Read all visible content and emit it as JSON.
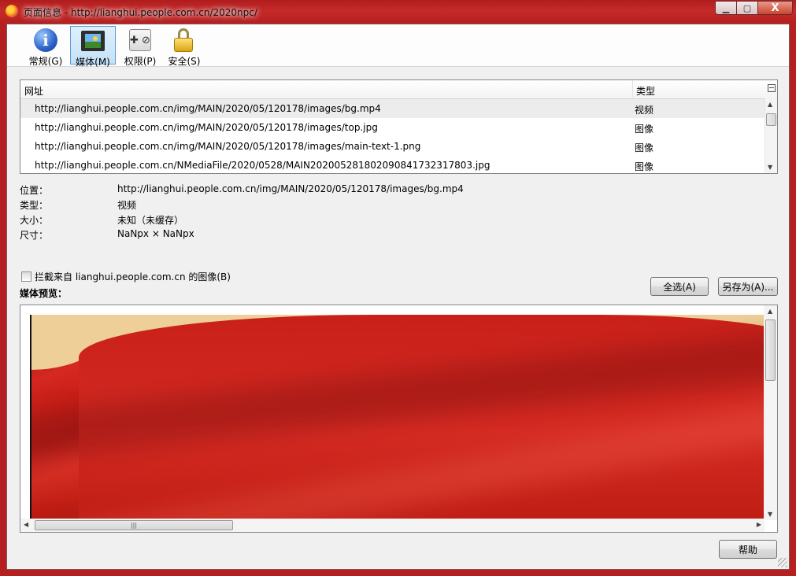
{
  "window": {
    "title": "页面信息 - http://lianghui.people.com.cn/2020npc/",
    "caption_buttons": {
      "minimize": "▁",
      "maximize": "▢",
      "close": "X"
    }
  },
  "toolbar": {
    "tabs": [
      {
        "label": "常规(G)",
        "icon": "info-icon",
        "selected": false
      },
      {
        "label": "媒体(M)",
        "icon": "media-icon",
        "selected": true
      },
      {
        "label": "权限(P)",
        "icon": "permissions-icon",
        "selected": false
      },
      {
        "label": "安全(S)",
        "icon": "lock-icon",
        "selected": false
      }
    ]
  },
  "media_table": {
    "headers": {
      "url": "网址",
      "type": "类型"
    },
    "rows": [
      {
        "url": "http://lianghui.people.com.cn/img/MAIN/2020/05/120178/images/bg.mp4",
        "type": "视频",
        "selected": true
      },
      {
        "url": "http://lianghui.people.com.cn/img/MAIN/2020/05/120178/images/top.jpg",
        "type": "图像",
        "selected": false
      },
      {
        "url": "http://lianghui.people.com.cn/img/MAIN/2020/05/120178/images/main-text-1.png",
        "type": "图像",
        "selected": false
      },
      {
        "url": "http://lianghui.people.com.cn/NMediaFile/2020/0528/MAIN202005281802090841732317803.jpg",
        "type": "图像",
        "selected": false
      }
    ]
  },
  "properties": {
    "location": {
      "label": "位置：",
      "value": "http://lianghui.people.com.cn/img/MAIN/2020/05/120178/images/bg.mp4"
    },
    "type": {
      "label": "类型：",
      "value": "视频"
    },
    "size": {
      "label": "大小：",
      "value": "未知（未缓存）"
    },
    "dimensions": {
      "label": "尺寸：",
      "value": "NaNpx × NaNpx"
    }
  },
  "block_images": {
    "label": "拦截来自 lianghui.people.com.cn 的图像(B)",
    "checked": false
  },
  "buttons": {
    "select_all": "全选(A)",
    "save_as": "另存为(A)...",
    "help": "帮助"
  },
  "preview": {
    "label": "媒体预览：",
    "hscroll_grip": "|||"
  },
  "colors": {
    "title_bar": "#b51f1f",
    "selection": "#c4e1f7",
    "video_red": "#c91d17",
    "video_cream": "#efcf98"
  }
}
